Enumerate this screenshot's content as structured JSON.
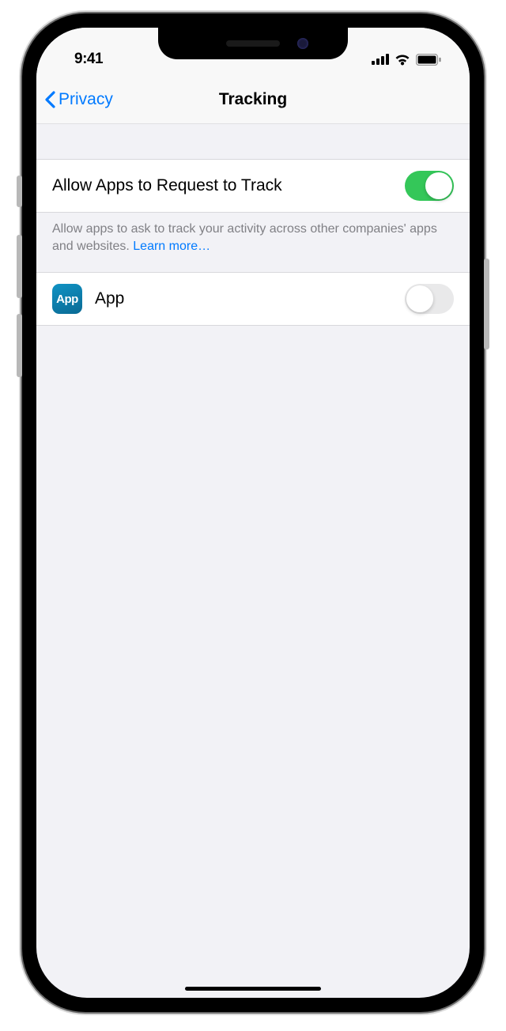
{
  "status": {
    "time": "9:41"
  },
  "nav": {
    "back_label": "Privacy",
    "title": "Tracking"
  },
  "allow_row": {
    "label": "Allow Apps to Request to Track",
    "toggle_on": true
  },
  "footer": {
    "text": "Allow apps to ask to track your activity across other companies' apps and websites. ",
    "link": "Learn more…"
  },
  "app_row": {
    "icon_label": "App",
    "label": "App",
    "toggle_on": false
  }
}
